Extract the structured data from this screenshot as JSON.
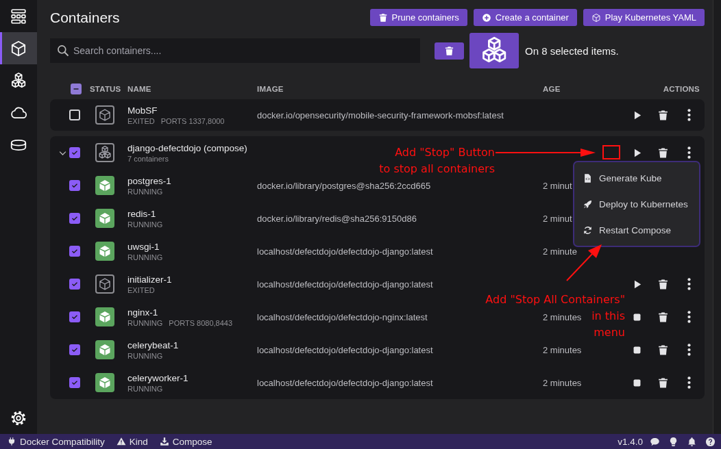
{
  "sidebar": {
    "items": [
      {
        "kind": "dashboard",
        "selected": false
      },
      {
        "kind": "containers",
        "selected": true
      },
      {
        "kind": "pods",
        "selected": false
      },
      {
        "kind": "kubernetes",
        "selected": false
      },
      {
        "kind": "volumes",
        "selected": false
      }
    ],
    "bottom_items": [
      {
        "kind": "settings",
        "selected": false
      }
    ]
  },
  "header": {
    "title": "Containers",
    "buttons": [
      {
        "kind": "prune",
        "label": "Prune containers"
      },
      {
        "kind": "create",
        "label": "Create a container"
      },
      {
        "kind": "kube",
        "label": "Play Kubernetes YAML"
      }
    ]
  },
  "search": {
    "placeholder": "Search containers...."
  },
  "bulk": {
    "message": "On 8 selected items."
  },
  "table": {
    "indeterminate": true,
    "columns": [
      {
        "label": "STATUS"
      },
      {
        "label": "NAME"
      },
      {
        "label": "IMAGE"
      },
      {
        "label": "AGE"
      },
      {
        "label": "ACTIONS"
      }
    ],
    "rows": [
      {
        "kind": "container",
        "name": "MobSF",
        "status": "EXITED",
        "ports": "PORTS 1337,8000",
        "image": "docker.io/opensecurity/mobile-security-framework-mobsf:latest",
        "running": false,
        "checked": false,
        "actions": [
          {
            "kind": "start"
          },
          {
            "kind": "delete"
          },
          {
            "kind": "more"
          }
        ]
      },
      {
        "kind": "group",
        "name": "django-defectdojo (compose)",
        "subtitle": "7 containers",
        "expanded": true,
        "checked": true,
        "actions": [
          {
            "kind": "start"
          },
          {
            "kind": "delete"
          },
          {
            "kind": "more"
          }
        ],
        "children": [
          {
            "name": "postgres-1",
            "status": "RUNNING",
            "image": "docker.io/library/postgres@sha256:2ccd665",
            "age": "2 minut",
            "running": true,
            "checked": true
          },
          {
            "name": "redis-1",
            "status": "RUNNING",
            "image": "docker.io/library/redis@sha256:9150d86",
            "age": "2 minut",
            "running": true,
            "checked": true
          },
          {
            "name": "uwsgi-1",
            "status": "RUNNING",
            "image": "localhost/defectdojo/defectdojo-django:latest",
            "age": "2 minute",
            "running": true,
            "checked": true
          },
          {
            "name": "initializer-1",
            "status": "EXITED",
            "image": "localhost/defectdojo/defectdojo-django:latest",
            "running": false,
            "checked": true,
            "actions": [
              {
                "kind": "start"
              },
              {
                "kind": "delete"
              },
              {
                "kind": "more"
              }
            ]
          },
          {
            "name": "nginx-1",
            "status": "RUNNING",
            "ports": "PORTS 8080,8443",
            "image": "localhost/defectdojo/defectdojo-nginx:latest",
            "age": "2 minutes",
            "running": true,
            "checked": true,
            "actions": [
              {
                "kind": "stop"
              },
              {
                "kind": "delete"
              },
              {
                "kind": "more"
              }
            ]
          },
          {
            "name": "celerybeat-1",
            "status": "RUNNING",
            "image": "localhost/defectdojo/defectdojo-django:latest",
            "age": "2 minutes",
            "running": true,
            "checked": true,
            "actions": [
              {
                "kind": "stop"
              },
              {
                "kind": "delete"
              },
              {
                "kind": "more"
              }
            ]
          },
          {
            "name": "celeryworker-1",
            "status": "RUNNING",
            "image": "localhost/defectdojo/defectdojo-django:latest",
            "age": "2 minutes",
            "running": true,
            "checked": true,
            "actions": [
              {
                "kind": "stop"
              },
              {
                "kind": "delete"
              },
              {
                "kind": "more"
              }
            ]
          }
        ]
      }
    ]
  },
  "menu": {
    "items": [
      {
        "kind": "generate",
        "label": "Generate Kube"
      },
      {
        "kind": "deploy",
        "label": "Deploy to Kubernetes"
      },
      {
        "kind": "restart",
        "label": "Restart Compose"
      }
    ]
  },
  "annotations": [
    {
      "lines": [
        "Add \"Stop\" Button",
        "to stop all containers"
      ]
    },
    {
      "lines": [
        "Add \"Stop All Containers\"",
        "in this",
        "menu"
      ]
    }
  ],
  "status_bar": {
    "left": [
      {
        "kind": "plug",
        "label": "Docker Compatibility"
      },
      {
        "kind": "warning",
        "label": "Kind"
      },
      {
        "kind": "download",
        "label": "Compose"
      }
    ],
    "version": "v1.4.0",
    "right_icons": [
      {
        "kind": "chat"
      },
      {
        "kind": "bulb"
      },
      {
        "kind": "bell"
      },
      {
        "kind": "help"
      }
    ]
  }
}
